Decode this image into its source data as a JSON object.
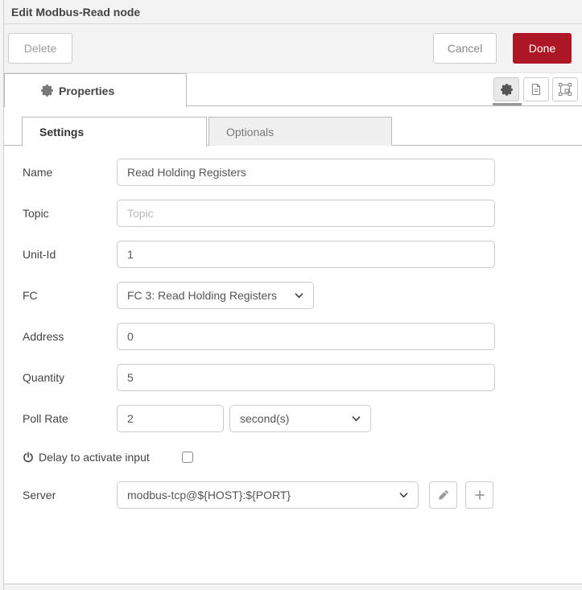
{
  "window": {
    "title": "Edit Modbus-Read node"
  },
  "toolbar": {
    "delete_label": "Delete",
    "cancel_label": "Cancel",
    "done_label": "Done"
  },
  "panel_tab": {
    "label": "Properties"
  },
  "tabs": {
    "settings": "Settings",
    "optionals": "Optionals"
  },
  "form": {
    "name": {
      "label": "Name",
      "value": "Read Holding Registers"
    },
    "topic": {
      "label": "Topic",
      "placeholder": "Topic"
    },
    "unit_id": {
      "label": "Unit-Id",
      "value": "1"
    },
    "fc": {
      "label": "FC",
      "value": "FC 3: Read Holding Registers"
    },
    "address": {
      "label": "Address",
      "value": "0"
    },
    "quantity": {
      "label": "Quantity",
      "value": "5"
    },
    "poll_rate": {
      "label": "Poll Rate",
      "value": "2",
      "unit": "second(s)"
    },
    "delay": {
      "label": "Delay to activate input",
      "checked": false
    },
    "server": {
      "label": "Server",
      "value": "modbus-tcp@${HOST}:${PORT}"
    }
  },
  "icons": {
    "panel": [
      "gear-icon",
      "doc-icon",
      "appearance-icon"
    ],
    "server_actions": [
      "edit-icon",
      "add-icon"
    ]
  },
  "colors": {
    "accent_red": "#AD1625",
    "header_bg": "#f3f3f3",
    "border": "#cccccc",
    "inactive_tab_bg": "#f0f0f0"
  }
}
